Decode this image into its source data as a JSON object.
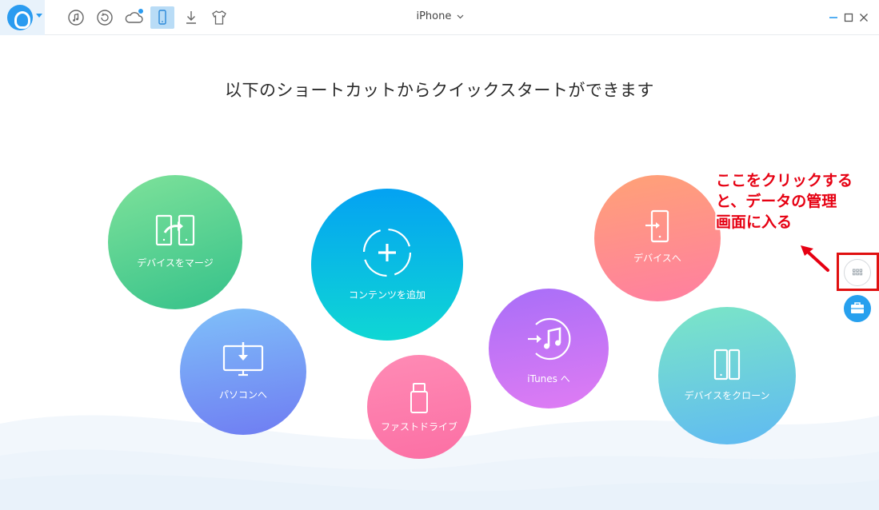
{
  "toolbar": {
    "device_name": "iPhone",
    "icons": [
      "app-logo",
      "music-note-icon",
      "restore-icon",
      "cloud-icon",
      "phone-icon",
      "download-icon",
      "tshirt-icon"
    ],
    "active_icon": "phone-icon",
    "window_controls": [
      "minimize-icon",
      "maximize-icon",
      "close-icon"
    ]
  },
  "headline": "以下のショートカットからクイックスタートができます",
  "shortcuts": {
    "merge": "デバイスをマージ",
    "to_pc": "パソコンへ",
    "add_content": "コンテンツを追加",
    "flash_drive": "ファストドライブ",
    "to_itunes": "iTunes へ",
    "to_device": "デバイスへ",
    "clone": "デバイスをクローン"
  },
  "annotation": {
    "line1": "ここをクリックする",
    "line2": "と、データの管理",
    "line3": "画面に入る"
  },
  "colors": {
    "accent": "#2a9bf0",
    "annotation_red": "#e60012"
  }
}
